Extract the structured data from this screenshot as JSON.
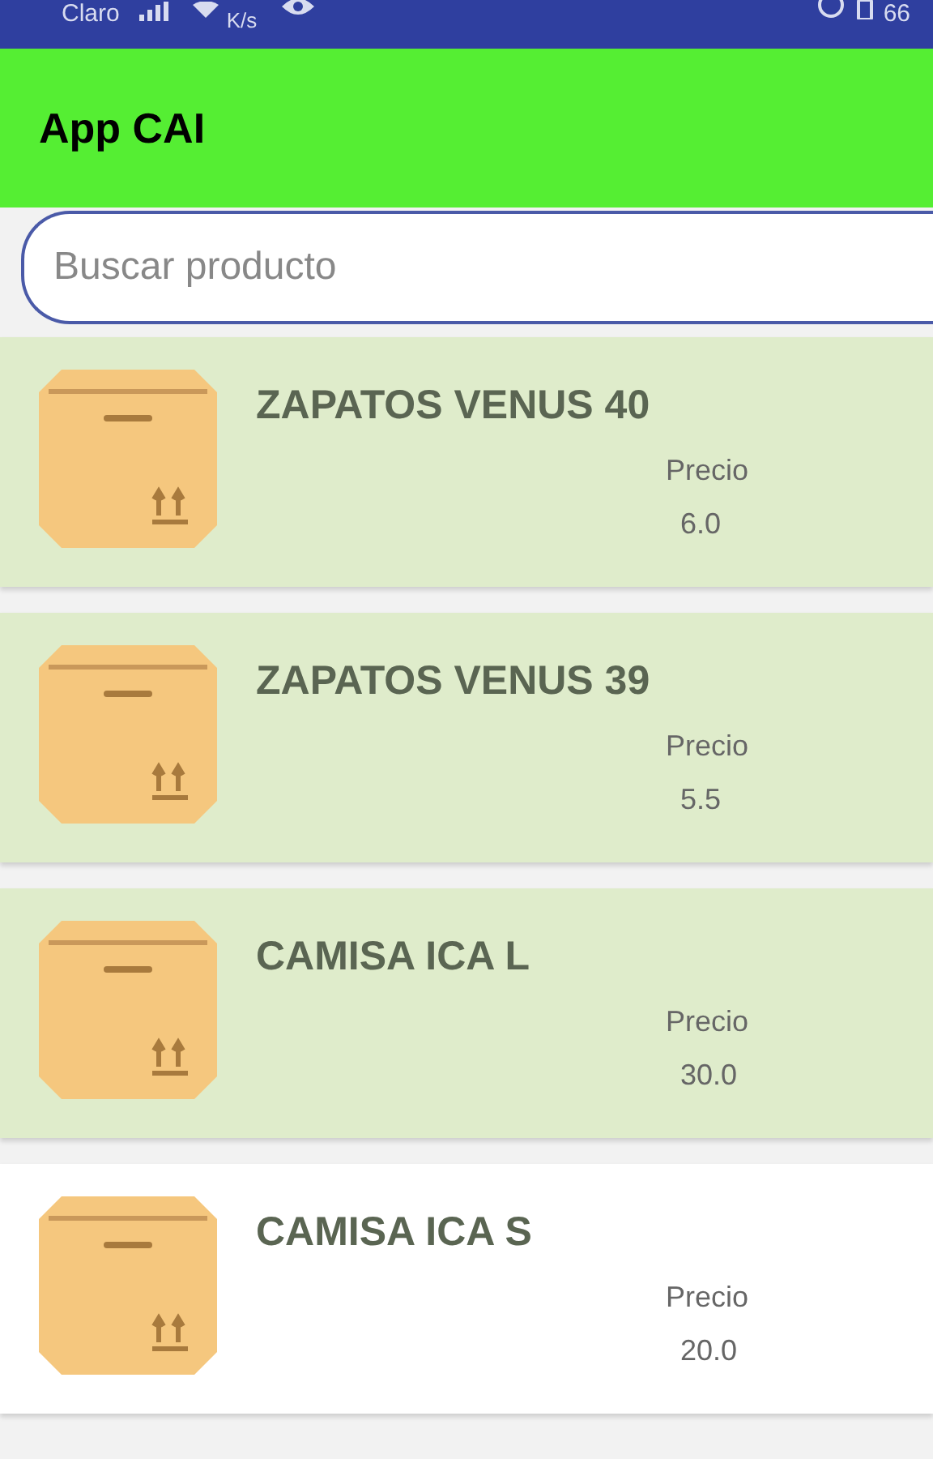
{
  "status_bar": {
    "carrier": "Claro",
    "speed": "K/s",
    "battery": "66"
  },
  "app_bar": {
    "title": "App CAI"
  },
  "search": {
    "placeholder": "Buscar producto"
  },
  "products": [
    {
      "name": "ZAPATOS VENUS 40",
      "price_label": "Precio",
      "price": "6.0",
      "highlighted": true
    },
    {
      "name": "ZAPATOS VENUS 39",
      "price_label": "Precio",
      "price": "5.5",
      "highlighted": true
    },
    {
      "name": "CAMISA ICA L",
      "price_label": "Precio",
      "price": "30.0",
      "highlighted": true
    },
    {
      "name": "CAMISA ICA S",
      "price_label": "Precio",
      "price": "20.0",
      "highlighted": false
    }
  ]
}
